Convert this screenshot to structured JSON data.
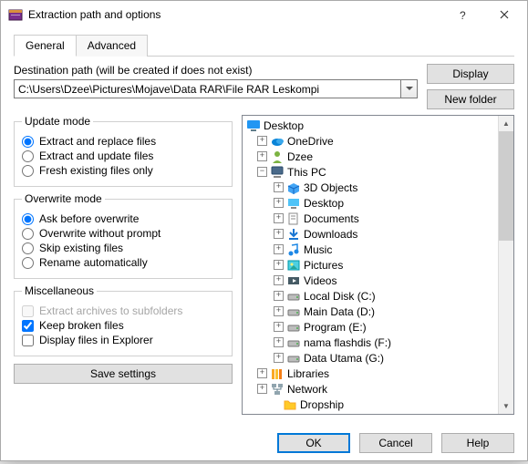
{
  "title": "Extraction path and options",
  "tabs": {
    "general": "General",
    "advanced": "Advanced"
  },
  "path": {
    "label": "Destination path (will be created if does not exist)",
    "value": "C:\\Users\\Dzee\\Pictures\\Mojave\\Data RAR\\File RAR Leskompi"
  },
  "buttons": {
    "display": "Display",
    "newfolder": "New folder",
    "save": "Save settings",
    "ok": "OK",
    "cancel": "Cancel",
    "help": "Help"
  },
  "groups": {
    "update": {
      "legend": "Update mode",
      "opt1": "Extract and replace files",
      "opt2": "Extract and update files",
      "opt3": "Fresh existing files only"
    },
    "overwrite": {
      "legend": "Overwrite mode",
      "opt1": "Ask before overwrite",
      "opt2": "Overwrite without prompt",
      "opt3": "Skip existing files",
      "opt4": "Rename automatically"
    },
    "misc": {
      "legend": "Miscellaneous",
      "opt1": "Extract archives to subfolders",
      "opt2": "Keep broken files",
      "opt3": "Display files in Explorer"
    }
  },
  "tree": {
    "desktop": "Desktop",
    "onedrive": "OneDrive",
    "dzee": "Dzee",
    "thispc": "This PC",
    "obj3d": "3D Objects",
    "desk": "Desktop",
    "docs": "Documents",
    "down": "Downloads",
    "music": "Music",
    "pics": "Pictures",
    "vids": "Videos",
    "c": "Local Disk (C:)",
    "d": "Main Data (D:)",
    "e": "Program (E:)",
    "f": "nama flashdis (F:)",
    "g": "Data Utama (G:)",
    "libs": "Libraries",
    "net": "Network",
    "drop": "Dropship"
  }
}
